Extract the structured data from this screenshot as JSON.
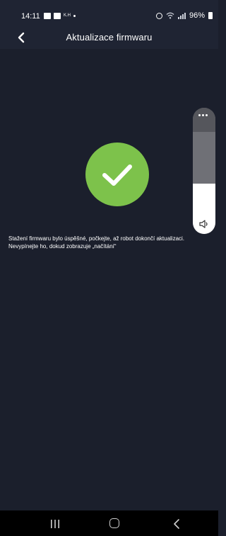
{
  "status_bar": {
    "time": "14:11",
    "notif_small": "K.H",
    "battery": "96%"
  },
  "header": {
    "back_icon": "chevron-left-icon",
    "title": "Aktualizace firmwaru"
  },
  "main": {
    "success_icon": "checkmark-circle-icon",
    "success_color": "#7dc24b",
    "message_line1": "Stažení firmwaru bylo úspěšné, počkejte, až robot dokončí aktualizaci.",
    "message_line2": "Nevypínejte ho, dokud zobrazuje „načítání“"
  },
  "volume_panel": {
    "more_icon": "more-dots-icon",
    "speaker_icon": "speaker-icon",
    "level": 0.4
  },
  "nav_bar": {
    "recents_icon": "recents-icon",
    "home_icon": "home-icon",
    "back_icon": "back-icon"
  },
  "colors": {
    "background": "#1b1f2c",
    "header": "#1f2433",
    "accent_green": "#7dc24b"
  }
}
